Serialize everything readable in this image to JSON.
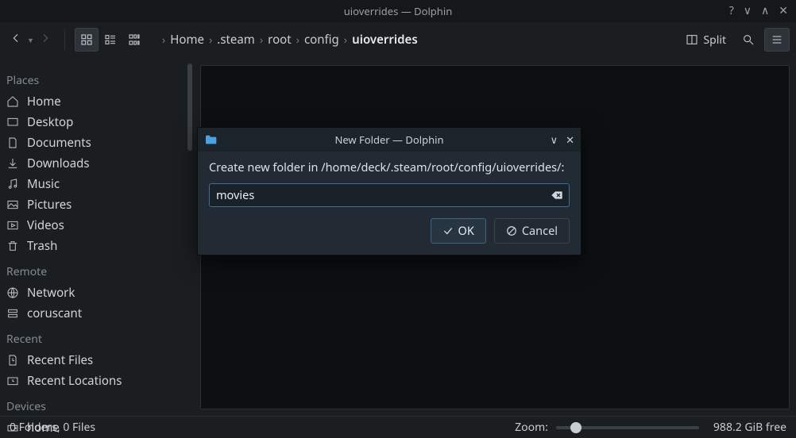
{
  "window": {
    "title": "uioverrides — Dolphin"
  },
  "breadcrumb": [
    "Home",
    ".steam",
    "root",
    "config",
    "uioverrides"
  ],
  "sidebar": {
    "sections": [
      {
        "title": "Places",
        "items": [
          "Home",
          "Desktop",
          "Documents",
          "Downloads",
          "Music",
          "Pictures",
          "Videos",
          "Trash"
        ]
      },
      {
        "title": "Remote",
        "items": [
          "Network",
          "coruscant"
        ]
      },
      {
        "title": "Recent",
        "items": [
          "Recent Files",
          "Recent Locations"
        ]
      },
      {
        "title": "Devices",
        "items": [
          "home"
        ]
      }
    ]
  },
  "toolbar_right": {
    "split_label": "Split"
  },
  "dialog": {
    "title": "New Folder — Dolphin",
    "prompt": "Create new folder in /home/deck/.steam/root/config/uioverrides/:",
    "input_value": "movies",
    "ok_label": "OK",
    "cancel_label": "Cancel"
  },
  "status": {
    "summary": "0 Folders, 0 Files",
    "zoom_label": "Zoom:",
    "free_space": "988.2 GiB free"
  }
}
